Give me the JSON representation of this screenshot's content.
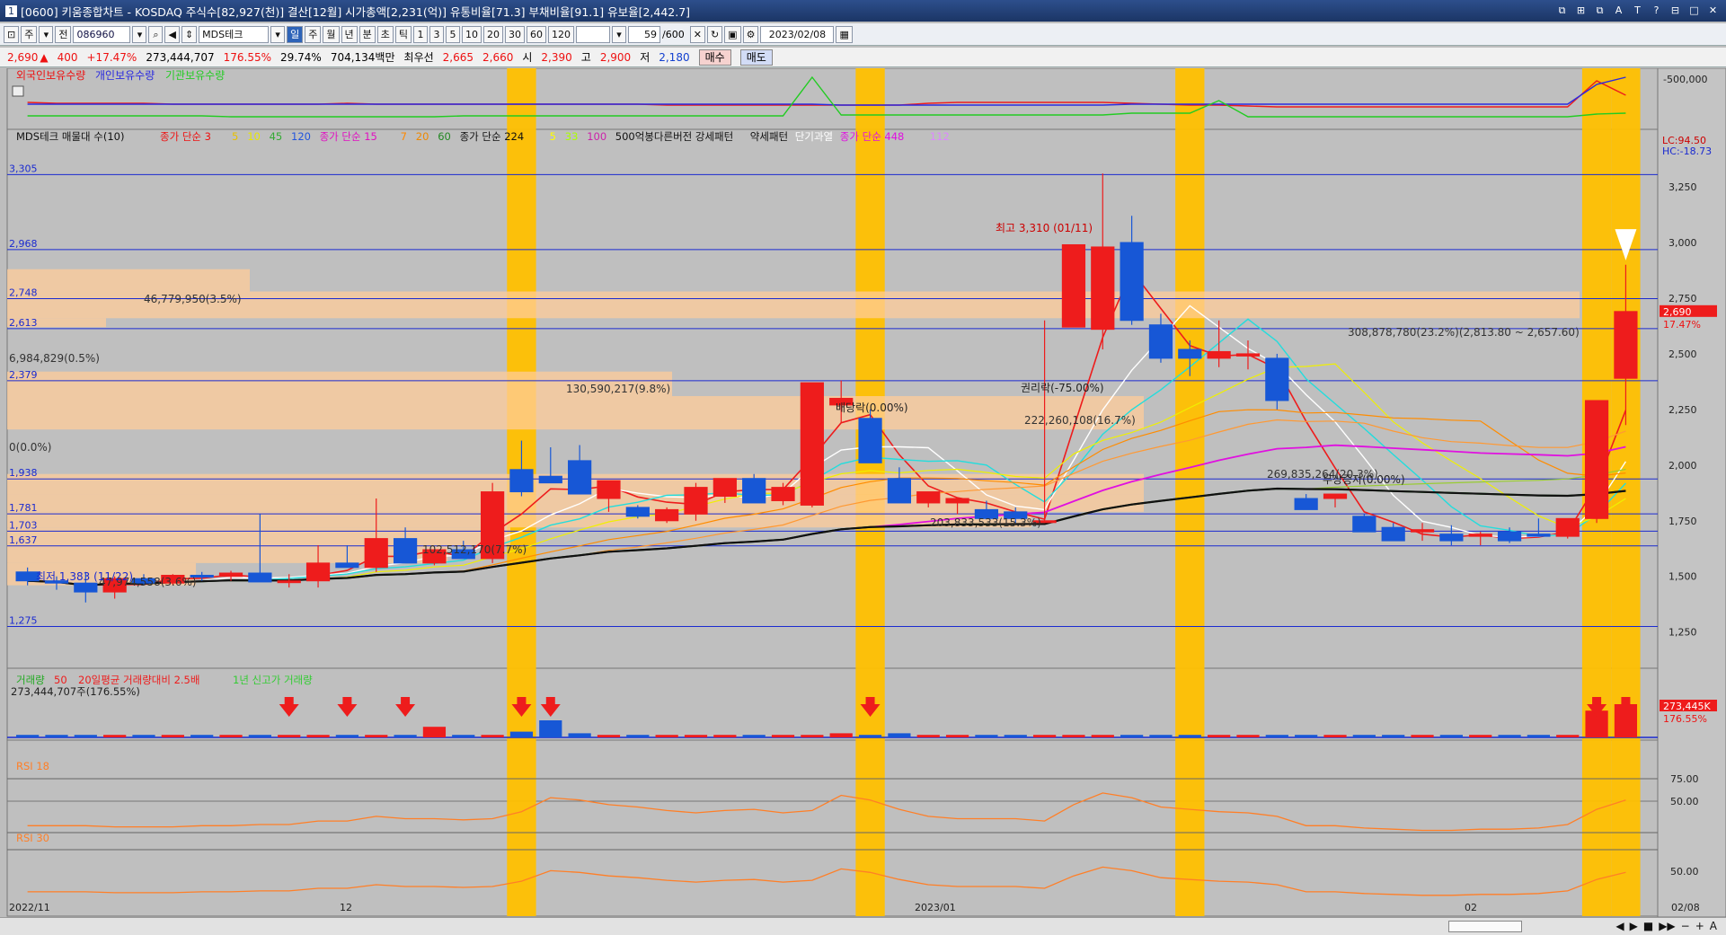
{
  "title": "[0600] 키움종합차트 - KOSDAQ 주식수[82,927(천)] 결산[12월] 시가총액[2,231(억)] 유통비율[71.3] 부채비율[91.1] 유보율[2,442.7]",
  "title_prefix": "1",
  "window_buttons": [
    "⧉",
    "⊞",
    "⧉",
    "A",
    "T",
    "?",
    "⊟",
    "□",
    "✕"
  ],
  "toolbar": {
    "mode": "주",
    "scope": "전",
    "code": "086960",
    "stock_name": "MDS테크",
    "periods": [
      "일",
      "주",
      "월",
      "년",
      "분",
      "초",
      "틱"
    ],
    "selected_period": "일",
    "intervals": [
      "1",
      "3",
      "5",
      "10",
      "20",
      "30",
      "60",
      "120"
    ],
    "count": "59",
    "count_total": "/600",
    "date": "2023/02/08"
  },
  "infobar": {
    "price": "2,690",
    "change": "400",
    "change_pct": "+17.47%",
    "volume": "273,444,707",
    "vol_ratio": "176.55%",
    "turnover": "29.74%",
    "amount": "704,134백만",
    "best_ask_label": "최우선",
    "best_ask": "2,665",
    "best_bid": "2,660",
    "open_label": "시",
    "open": "2,390",
    "high_label": "고",
    "high": "2,900",
    "low_label": "저",
    "low": "2,180",
    "buy_btn": "매수",
    "sell_btn": "매도"
  },
  "colors": {
    "up": "#ee1c1c",
    "down": "#1757d6",
    "highlight": "#ffc000",
    "band": "#ffcc99",
    "hline": "#1a2ad0"
  },
  "pane_top": {
    "legend": [
      {
        "text": "외국인보유수량",
        "color": "#e11"
      },
      {
        "text": "개인보유수량",
        "color": "#2a2ae0"
      },
      {
        "text": "기관보유수량",
        "color": "#22cc22"
      }
    ],
    "axis_label": "-500,000"
  },
  "pane_price": {
    "legend": [
      {
        "text": "MDS테크 매물대 수(10)",
        "color": "#111"
      },
      {
        "text": "종가 단순 3",
        "color": "#e11"
      },
      {
        "text": "5",
        "color": "#e8c000"
      },
      {
        "text": "10",
        "color": "#e8e800"
      },
      {
        "text": "45",
        "color": "#33aa33"
      },
      {
        "text": "120",
        "color": "#2255dd"
      },
      {
        "text": "종가 단순 15",
        "color": "#e010c0"
      },
      {
        "text": "7",
        "color": "#ff8800"
      },
      {
        "text": "20",
        "color": "#ee8800"
      },
      {
        "text": "60",
        "color": "#228822"
      },
      {
        "text": "종가 단순 224",
        "color": "#111"
      },
      {
        "text": "5",
        "color": "#ffff00"
      },
      {
        "text": "33",
        "color": "#aaff00"
      },
      {
        "text": "100",
        "color": "#cc22aa"
      },
      {
        "text": "500억봉다른버전 강세패턴",
        "color": "#111"
      },
      {
        "text": "약세패턴",
        "color": "#111"
      },
      {
        "text": "단기과열",
        "color": "#ffffff"
      },
      {
        "text": "종가 단순 448",
        "color": "#e010e0"
      },
      {
        "text": "112",
        "color": "#dd88ff"
      }
    ],
    "lc": "LC:94.50",
    "hc": "HC:-18.73",
    "price_ticks": [
      "3,250",
      "3,000",
      "2,750",
      "2,500",
      "2,250",
      "2,000",
      "1,750",
      "1,500",
      "1,250"
    ],
    "last_price_tag": "2,690",
    "last_pct_tag": "17.47%",
    "level_labels": [
      "3,305",
      "2,968",
      "2,748",
      "2,613",
      "2,379",
      "1,938",
      "1,781",
      "1,703",
      "1,637",
      "1,275"
    ],
    "volume_profile_labels": [
      "46,779,950(3.5%)",
      "6,984,829(0.5%)",
      "130,590,217(9.8%)",
      "0(0.0%)",
      "308,878,780(23.2%)(2,813.80 ~ 2,657.60)",
      "222,260,108(16.7%)",
      "269,835,264(20.3%)",
      "203,833,533(15.3%)",
      "102,512,170(7.7%)",
      "47,974,558(3.6%)"
    ],
    "annotations": [
      "최고 3,310 (01/11)",
      "최저 1,383 (11/22)",
      "권리락(-75.00%)",
      "배당락(0.00%)",
      "무상증자(0.00%)"
    ]
  },
  "pane_volume": {
    "legend": [
      {
        "text": "거래량",
        "color": "#22aa22"
      },
      {
        "text": "50",
        "color": "#ee1c1c"
      },
      {
        "text": "20일평균 거래량대비 2.5배",
        "color": "#ee1c1c"
      },
      {
        "text": "1년 신고가 거래량",
        "color": "#33cc33"
      }
    ],
    "sub": "273,444,707주(176.55%)",
    "tag_value": "273,445K",
    "tag_pct": "176.55%"
  },
  "pane_rsi18": {
    "legend": "RSI 18",
    "ticks": [
      "75.00",
      "50.00"
    ]
  },
  "pane_rsi30": {
    "legend": "RSI 30",
    "ticks": [
      "50.00"
    ]
  },
  "x_axis": [
    "2022/11",
    "12",
    "2023/01",
    "02",
    "02/08"
  ],
  "chart_data": {
    "type": "candlestick",
    "days": [
      {
        "o": 1520,
        "h": 1540,
        "l": 1460,
        "c": 1480
      },
      {
        "o": 1480,
        "h": 1500,
        "l": 1440,
        "c": 1470
      },
      {
        "o": 1470,
        "h": 1520,
        "l": 1383,
        "c": 1430
      },
      {
        "o": 1430,
        "h": 1500,
        "l": 1400,
        "c": 1490
      },
      {
        "o": 1490,
        "h": 1510,
        "l": 1460,
        "c": 1470
      },
      {
        "o": 1470,
        "h": 1510,
        "l": 1460,
        "c": 1505
      },
      {
        "o": 1505,
        "h": 1520,
        "l": 1480,
        "c": 1500
      },
      {
        "o": 1500,
        "h": 1525,
        "l": 1480,
        "c": 1515
      },
      {
        "o": 1515,
        "h": 1780,
        "l": 1480,
        "c": 1475
      },
      {
        "o": 1475,
        "h": 1510,
        "l": 1450,
        "c": 1480
      },
      {
        "o": 1480,
        "h": 1640,
        "l": 1450,
        "c": 1560
      },
      {
        "o": 1560,
        "h": 1640,
        "l": 1540,
        "c": 1540
      },
      {
        "o": 1540,
        "h": 1850,
        "l": 1520,
        "c": 1670
      },
      {
        "o": 1670,
        "h": 1720,
        "l": 1580,
        "c": 1560
      },
      {
        "o": 1560,
        "h": 1620,
        "l": 1550,
        "c": 1620
      },
      {
        "o": 1620,
        "h": 1660,
        "l": 1580,
        "c": 1580
      },
      {
        "o": 1580,
        "h": 1920,
        "l": 1560,
        "c": 1880
      },
      {
        "o": 1980,
        "h": 2110,
        "l": 1860,
        "c": 1880
      },
      {
        "o": 1950,
        "h": 2080,
        "l": 1930,
        "c": 1920
      },
      {
        "o": 2020,
        "h": 2090,
        "l": 1880,
        "c": 1870
      },
      {
        "o": 1850,
        "h": 1930,
        "l": 1790,
        "c": 1930
      },
      {
        "o": 1810,
        "h": 1820,
        "l": 1760,
        "c": 1770
      },
      {
        "o": 1750,
        "h": 1810,
        "l": 1740,
        "c": 1800
      },
      {
        "o": 1780,
        "h": 1920,
        "l": 1750,
        "c": 1900
      },
      {
        "o": 1860,
        "h": 1940,
        "l": 1830,
        "c": 1940
      },
      {
        "o": 1940,
        "h": 1960,
        "l": 1840,
        "c": 1830
      },
      {
        "o": 1840,
        "h": 1920,
        "l": 1820,
        "c": 1900
      },
      {
        "o": 1820,
        "h": 2000,
        "l": 1810,
        "c": 2370
      },
      {
        "o": 2270,
        "h": 2380,
        "l": 2190,
        "c": 2300
      },
      {
        "o": 2210,
        "h": 2250,
        "l": 2010,
        "c": 2010
      },
      {
        "o": 1940,
        "h": 1990,
        "l": 1850,
        "c": 1830
      },
      {
        "o": 1830,
        "h": 1880,
        "l": 1810,
        "c": 1880
      },
      {
        "o": 1830,
        "h": 1850,
        "l": 1780,
        "c": 1850
      },
      {
        "o": 1800,
        "h": 1840,
        "l": 1760,
        "c": 1760
      },
      {
        "o": 1790,
        "h": 1810,
        "l": 1740,
        "c": 1760
      },
      {
        "o": 1750,
        "h": 2650,
        "l": 1740,
        "c": 1750
      },
      {
        "o": 2620,
        "h": 2680,
        "l": 2620,
        "c": 2990
      },
      {
        "o": 2610,
        "h": 3310,
        "l": 2520,
        "c": 2980
      },
      {
        "o": 3000,
        "h": 3120,
        "l": 2630,
        "c": 2650
      },
      {
        "o": 2630,
        "h": 2680,
        "l": 2460,
        "c": 2480
      },
      {
        "o": 2520,
        "h": 2560,
        "l": 2400,
        "c": 2480
      },
      {
        "o": 2480,
        "h": 2650,
        "l": 2440,
        "c": 2510
      },
      {
        "o": 2490,
        "h": 2560,
        "l": 2430,
        "c": 2500
      },
      {
        "o": 2480,
        "h": 2500,
        "l": 2250,
        "c": 2290
      },
      {
        "o": 1850,
        "h": 1870,
        "l": 1800,
        "c": 1800
      },
      {
        "o": 1850,
        "h": 1860,
        "l": 1810,
        "c": 1870
      },
      {
        "o": 1770,
        "h": 1780,
        "l": 1700,
        "c": 1700
      },
      {
        "o": 1720,
        "h": 1740,
        "l": 1660,
        "c": 1660
      },
      {
        "o": 1700,
        "h": 1740,
        "l": 1660,
        "c": 1710
      },
      {
        "o": 1690,
        "h": 1730,
        "l": 1640,
        "c": 1660
      },
      {
        "o": 1680,
        "h": 1700,
        "l": 1640,
        "c": 1690
      },
      {
        "o": 1700,
        "h": 1720,
        "l": 1650,
        "c": 1660
      },
      {
        "o": 1690,
        "h": 1760,
        "l": 1680,
        "c": 1680
      },
      {
        "o": 1680,
        "h": 1760,
        "l": 1670,
        "c": 1760
      },
      {
        "o": 1760,
        "h": 2290,
        "l": 1740,
        "c": 2290
      },
      {
        "o": 2390,
        "h": 2900,
        "l": 2180,
        "c": 2690
      }
    ],
    "highlight_days": [
      17,
      29,
      40,
      54,
      55
    ],
    "y_range": [
      1200,
      3400
    ]
  }
}
